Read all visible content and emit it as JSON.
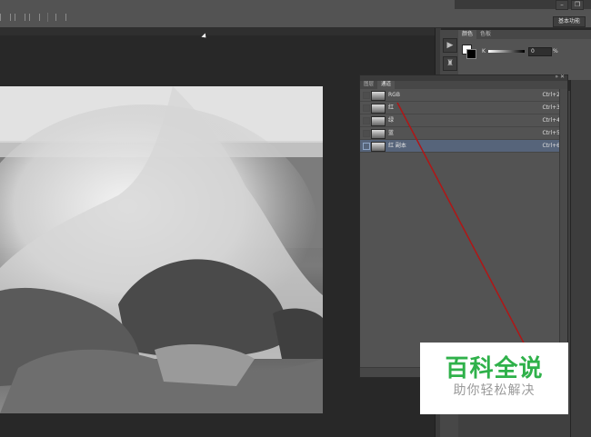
{
  "workspace_label": "基本功能",
  "color_panel": {
    "tabs": [
      "颜色",
      "色板"
    ],
    "channel_label": "K",
    "value": "0",
    "unit": "%"
  },
  "channels_panel": {
    "tabs": [
      "图层",
      "通道"
    ],
    "active_tab": "通道",
    "rows": [
      {
        "name": "RGB",
        "shortcut": "Ctrl+2",
        "visible": false,
        "selected": false
      },
      {
        "name": "红",
        "shortcut": "Ctrl+3",
        "visible": false,
        "selected": false
      },
      {
        "name": "绿",
        "shortcut": "Ctrl+4",
        "visible": false,
        "selected": false
      },
      {
        "name": "蓝",
        "shortcut": "Ctrl+5",
        "visible": false,
        "selected": false
      },
      {
        "name": "红 副本",
        "shortcut": "Ctrl+6",
        "visible": true,
        "selected": true
      }
    ]
  },
  "annotation_color": "#b01616",
  "watermark": {
    "title": "百科全说",
    "subtitle": "助你轻松解决",
    "title_color": "#2fb14a"
  }
}
